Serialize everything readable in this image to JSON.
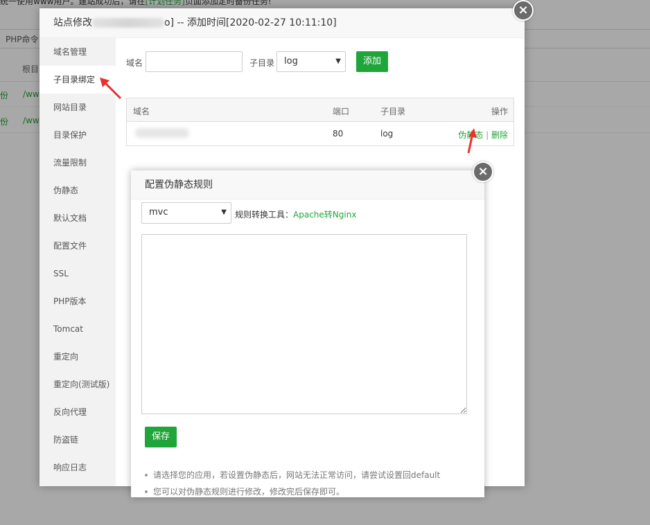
{
  "background": {
    "notice_prefix": "统一使用www用户。建站成功后，请在",
    "notice_link": "[计划任务]",
    "notice_suffix": "页面添加定时备份任务!",
    "tab_label": "PHP命令",
    "column_root": "根目",
    "rows": [
      {
        "col1": "份",
        "col2": "/ww"
      },
      {
        "col1": "份",
        "col2": "/ww"
      }
    ]
  },
  "site_modal": {
    "title_prefix": "站点修改",
    "title_suffix": "o] -- 添加时间[2020-02-27 10:11:10]",
    "close_glyph": "×",
    "sidebar": [
      {
        "label": "域名管理"
      },
      {
        "label": "子目录绑定"
      },
      {
        "label": "网站目录"
      },
      {
        "label": "目录保护"
      },
      {
        "label": "流量限制"
      },
      {
        "label": "伪静态"
      },
      {
        "label": "默认文档"
      },
      {
        "label": "配置文件"
      },
      {
        "label": "SSL"
      },
      {
        "label": "PHP版本"
      },
      {
        "label": "Tomcat"
      },
      {
        "label": "重定向"
      },
      {
        "label": "重定向(测试版)"
      },
      {
        "label": "反向代理"
      },
      {
        "label": "防盗链"
      },
      {
        "label": "响应日志"
      }
    ],
    "active_index": 1,
    "form": {
      "domain_label": "域名",
      "domain_value": "",
      "subdir_label": "子目录",
      "subdir_value": "log",
      "add_button": "添加"
    },
    "table": {
      "headers": {
        "domain": "域名",
        "port": "端口",
        "subdir": "子目录",
        "ops": "操作"
      },
      "rows": [
        {
          "port": "80",
          "subdir": "log",
          "op_rewrite": "伪静态",
          "op_sep": "|",
          "op_delete": "删除"
        }
      ]
    }
  },
  "rewrite_modal": {
    "title": "配置伪静态规则",
    "close_glyph": "×",
    "select_value": "mvc",
    "tool_label": "规则转换工具：",
    "tool_link": "Apache转Nginx",
    "textarea_value": "",
    "save_button": "保存",
    "tips": [
      "请选择您的应用，若设置伪静态后，网站无法正常访问，请尝试设置回default",
      "您可以对伪静态规则进行修改，修改完后保存即可。"
    ]
  },
  "colors": {
    "accent_green": "#20a53a",
    "arrow_red": "#e8322e"
  }
}
